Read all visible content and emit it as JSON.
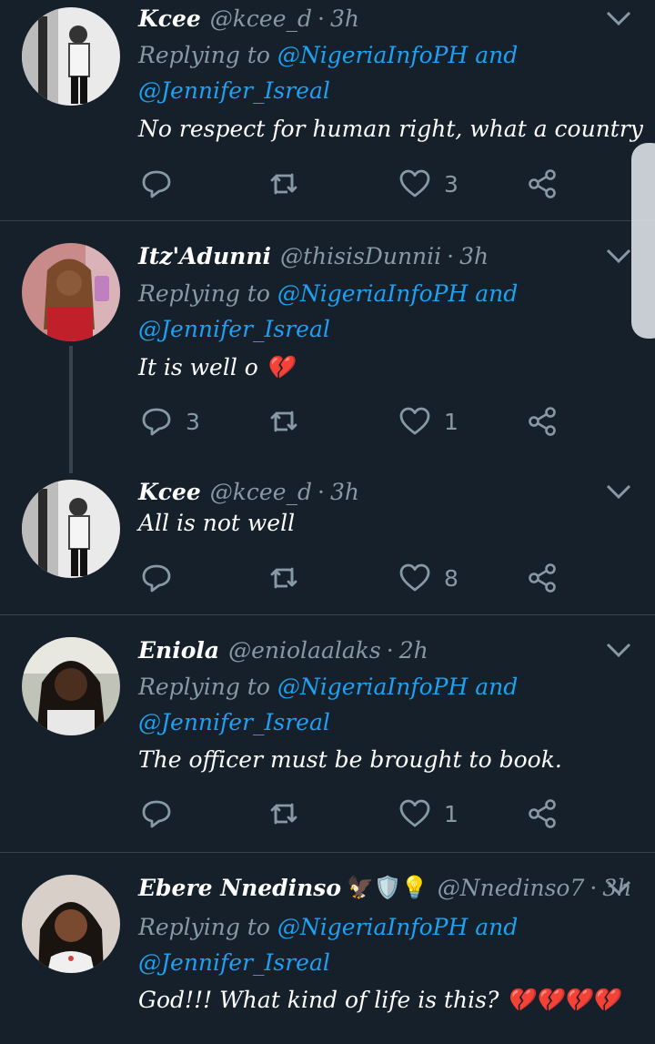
{
  "tweets": [
    {
      "name": "Kcee",
      "handle": "@kcee_d",
      "time": "3h",
      "replying_prefix": "Replying to",
      "reply_to_1": "@NigeriaInfoPH",
      "reply_and": "and",
      "reply_to_2": "@Jennifer_Isreal",
      "text": "No respect for human right, what a country",
      "reply_count": "",
      "retweet_count": "",
      "like_count": "3"
    },
    {
      "name": "Itz'Adunni",
      "handle": "@thisisDunnii",
      "time": "3h",
      "replying_prefix": "Replying to",
      "reply_to_1": "@NigeriaInfoPH",
      "reply_and": "and",
      "reply_to_2": "@Jennifer_Isreal",
      "text": "It is well o",
      "emoji": "💔",
      "reply_count": "3",
      "retweet_count": "",
      "like_count": "1"
    },
    {
      "name": "Kcee",
      "handle": "@kcee_d",
      "time": "3h",
      "text": "All is not well",
      "reply_count": "",
      "retweet_count": "",
      "like_count": "8"
    },
    {
      "name": "Eniola",
      "handle": "@eniolaalaks",
      "time": "2h",
      "replying_prefix": "Replying to",
      "reply_to_1": "@NigeriaInfoPH",
      "reply_and": "and",
      "reply_to_2": "@Jennifer_Isreal",
      "text": "The officer must be brought to book.",
      "reply_count": "",
      "retweet_count": "",
      "like_count": "1"
    },
    {
      "name": "Ebere Nnedinso",
      "name_emoji": "🦅🛡️💡",
      "handle": "@Nnedinso7",
      "time": "3h",
      "replying_prefix": "Replying to",
      "reply_to_1": "@NigeriaInfoPH",
      "reply_and": "and",
      "reply_to_2": "@Jennifer_Isreal",
      "text": "God!!! What kind of life is this?",
      "emoji": "💔💔💔💔"
    }
  ],
  "separator": "·",
  "icons": {
    "reply": "reply-icon",
    "retweet": "retweet-icon",
    "like": "heart-icon",
    "share": "share-icon",
    "more": "chevron-down-icon"
  },
  "colors": {
    "background": "#15202b",
    "muted": "#8899a6",
    "link": "#1da1f2",
    "divider": "#38444d",
    "heartbreak": "#e0245e"
  }
}
